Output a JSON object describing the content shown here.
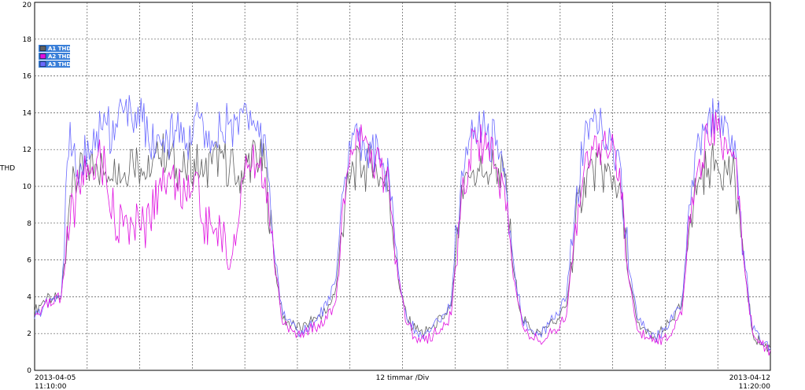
{
  "chart_data": {
    "type": "line",
    "title": "",
    "ylabel": "THD",
    "xlabel": "12 timmar /Div",
    "ylim": [
      0,
      20
    ],
    "yticks": [
      0,
      2,
      4,
      6,
      8,
      10,
      12,
      14,
      16,
      18,
      20
    ],
    "x_start": {
      "date": "2013-04-05",
      "time": "11:10:00"
    },
    "x_end": {
      "date": "2013-04-12",
      "time": "11:20:00"
    },
    "x_divisions": 14,
    "grid": true,
    "legend_position": "top-left",
    "series": [
      {
        "name": "A1 THD",
        "color": "#606060",
        "values": [
          3.2,
          3.8,
          3.9,
          4.0,
          9.5,
          10.5,
          11.0,
          11.2,
          10.8,
          11.5,
          10.5,
          12.0,
          11.0,
          10.5,
          11.5,
          12.0,
          11.0,
          10.8,
          11.5,
          10.5,
          11.2,
          11.8,
          11.0,
          10.6,
          11.3,
          11.7,
          11.0,
          6.0,
          2.8,
          2.5,
          2.2,
          2.6,
          3.0,
          3.2,
          4.5,
          9.0,
          11.0,
          10.8,
          11.2,
          10.5,
          9.8,
          5.0,
          2.8,
          2.2,
          2.0,
          2.5,
          2.8,
          3.5,
          8.5,
          10.5,
          11.0,
          10.8,
          11.2,
          10.5,
          5.5,
          2.8,
          2.2,
          2.1,
          2.4,
          2.8,
          3.5,
          8.0,
          10.5,
          11.0,
          10.8,
          10.5,
          10.2,
          5.0,
          2.6,
          2.0,
          1.8,
          2.2,
          2.8,
          3.5,
          8.5,
          10.5,
          11.0,
          11.2,
          11.0,
          10.5,
          6.0,
          2.0,
          1.4,
          1.2
        ]
      },
      {
        "name": "A2 THD",
        "color": "#e010e0",
        "values": [
          3.0,
          3.5,
          3.6,
          4.0,
          8.0,
          10.0,
          11.2,
          11.5,
          11.0,
          8.2,
          7.8,
          8.0,
          7.6,
          8.2,
          10.0,
          10.5,
          10.2,
          9.5,
          10.5,
          8.0,
          7.8,
          7.5,
          5.5,
          8.0,
          11.0,
          11.2,
          10.5,
          6.0,
          2.5,
          2.2,
          1.8,
          2.2,
          2.5,
          2.8,
          3.8,
          9.0,
          12.0,
          12.5,
          12.0,
          11.0,
          10.0,
          5.0,
          2.5,
          1.8,
          1.6,
          2.0,
          2.2,
          3.0,
          8.2,
          11.5,
          12.5,
          12.0,
          11.0,
          10.0,
          5.0,
          2.5,
          1.8,
          1.6,
          2.0,
          2.2,
          3.0,
          8.0,
          11.0,
          12.0,
          12.5,
          12.0,
          11.0,
          5.0,
          2.2,
          1.8,
          1.5,
          1.8,
          2.2,
          3.0,
          8.0,
          11.5,
          12.5,
          13.0,
          12.5,
          11.5,
          6.0,
          2.0,
          1.4,
          1.1
        ]
      },
      {
        "name": "A3 THD",
        "color": "#6a6aff",
        "values": [
          2.8,
          3.5,
          3.8,
          4.0,
          13.5,
          10.0,
          12.5,
          13.0,
          13.5,
          12.5,
          14.0,
          13.5,
          14.8,
          12.0,
          12.8,
          12.5,
          13.0,
          12.0,
          13.8,
          13.5,
          12.5,
          13.0,
          13.5,
          12.8,
          13.8,
          13.0,
          12.8,
          6.5,
          3.0,
          2.5,
          2.0,
          2.5,
          3.0,
          3.5,
          5.0,
          10.5,
          12.8,
          12.5,
          12.0,
          11.5,
          10.5,
          5.5,
          2.8,
          2.2,
          2.0,
          2.5,
          3.0,
          3.8,
          9.5,
          12.5,
          13.0,
          12.8,
          12.2,
          11.0,
          6.0,
          2.8,
          2.2,
          2.0,
          2.5,
          3.0,
          4.0,
          9.0,
          12.5,
          13.5,
          13.2,
          12.5,
          11.5,
          5.5,
          2.8,
          2.2,
          1.8,
          2.2,
          2.8,
          3.8,
          9.0,
          12.5,
          13.8,
          14.0,
          13.5,
          12.5,
          6.5,
          2.2,
          1.5,
          1.2
        ]
      }
    ]
  }
}
